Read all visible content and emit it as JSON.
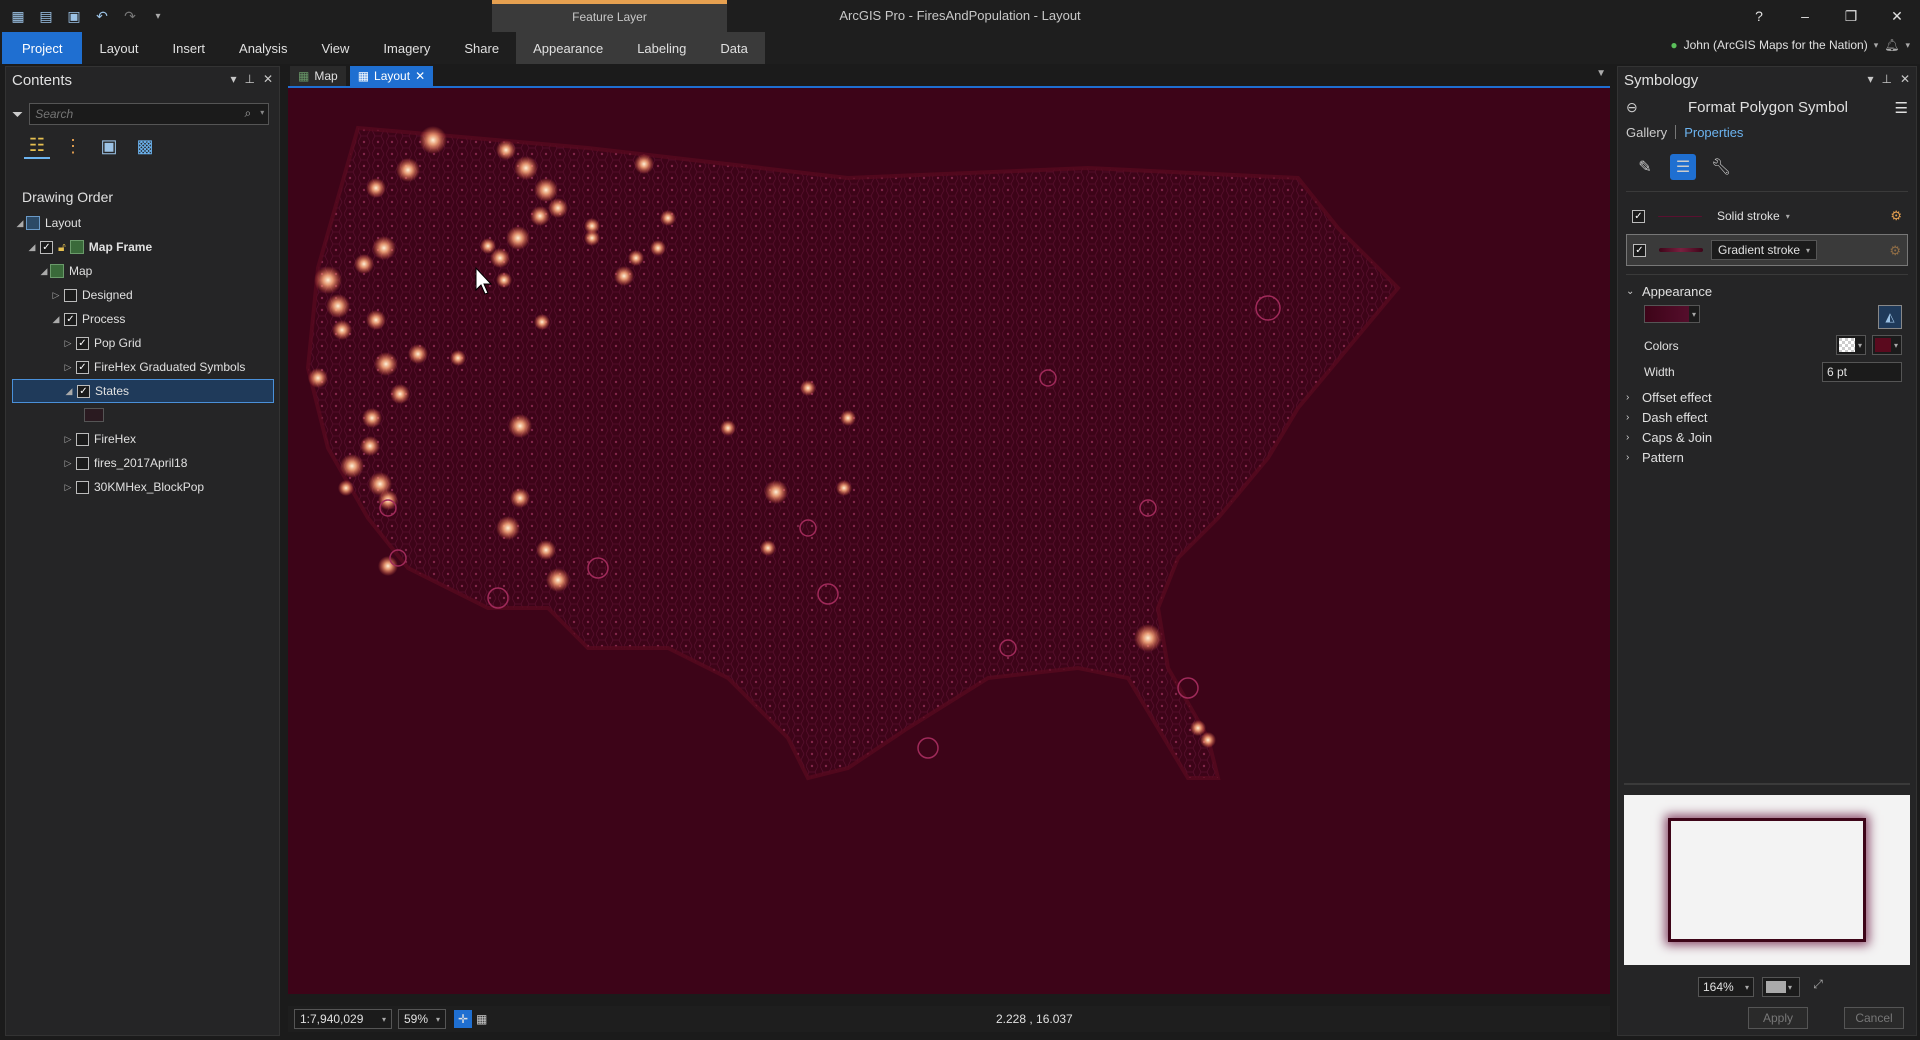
{
  "window": {
    "title": "ArcGIS Pro - FiresAndPopulation - Layout",
    "context_tab_header": "Feature Layer",
    "help": "?",
    "minimize": "–",
    "maximize": "❐",
    "close": "✕"
  },
  "ribbon": {
    "tabs": [
      "Project",
      "Layout",
      "Insert",
      "Analysis",
      "View",
      "Imagery",
      "Share",
      "Appearance",
      "Labeling",
      "Data"
    ],
    "user": "John (ArcGIS Maps for the Nation)"
  },
  "contents": {
    "title": "Contents",
    "search_placeholder": "Search",
    "drawing_order_label": "Drawing Order",
    "tree": [
      {
        "label": "Layout"
      },
      {
        "label": "Map Frame"
      },
      {
        "label": "Map"
      },
      {
        "label": "Designed"
      },
      {
        "label": "Process"
      },
      {
        "label": "Pop Grid"
      },
      {
        "label": "FireHex Graduated Symbols"
      },
      {
        "label": "States"
      },
      {
        "label": "FireHex"
      },
      {
        "label": "fires_2017April18"
      },
      {
        "label": "30KMHex_BlockPop"
      }
    ]
  },
  "map_tabs": [
    {
      "label": "Map"
    },
    {
      "label": "Layout"
    }
  ],
  "status_bar": {
    "scale": "1:7,940,029",
    "zoom": "59%",
    "coordinates": "2.228 , 16.037"
  },
  "symbology": {
    "title": "Symbology",
    "subtitle": "Format Polygon Symbol",
    "tab_gallery": "Gallery",
    "tab_properties": "Properties",
    "layers": [
      {
        "label": "Solid stroke",
        "color": "#5a1030"
      },
      {
        "label": "Gradient stroke",
        "color": "#7a2040"
      }
    ],
    "appearance_label": "Appearance",
    "colors_label": "Colors",
    "width_label": "Width",
    "width_value": "6 pt",
    "sections": [
      "Offset effect",
      "Dash effect",
      "Caps & Join",
      "Pattern"
    ],
    "preview_zoom": "164%",
    "apply_label": "Apply",
    "cancel_label": "Cancel",
    "color_primary": "#5a0a1e",
    "color_secondary": "#ffffff"
  },
  "colors": {
    "map_background": "#3d0418",
    "accent": "#1f6fd1",
    "hex_stroke": "#a02a5a",
    "glow": "#ffd0a0"
  }
}
